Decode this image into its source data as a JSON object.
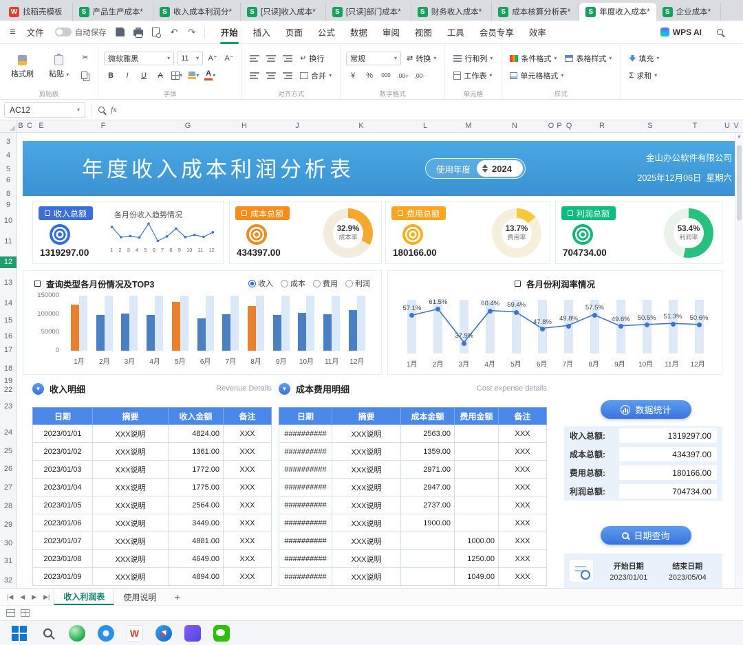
{
  "window_tabs": [
    {
      "label": "找稻壳模板",
      "app": "writer",
      "active": false
    },
    {
      "label": "产品生产成本*",
      "app": "et",
      "active": false
    },
    {
      "label": "收入成本利润分*",
      "app": "et",
      "active": false
    },
    {
      "label": "[只读]收入成本*",
      "app": "et",
      "active": false
    },
    {
      "label": "[只读]部门成本*",
      "app": "et",
      "active": false
    },
    {
      "label": "财务收入成本*",
      "app": "et",
      "active": false
    },
    {
      "label": "成本核算分析表*",
      "app": "et",
      "active": false
    },
    {
      "label": "年度收入成本*",
      "app": "et",
      "active": true
    },
    {
      "label": "企业成本*",
      "app": "et",
      "active": false
    }
  ],
  "menubar": {
    "file_label": "文件",
    "autosave_label": "自动保存",
    "autosave_on": false,
    "tabs": [
      "开始",
      "插入",
      "页面",
      "公式",
      "数据",
      "审阅",
      "视图",
      "工具",
      "会员专享",
      "效率"
    ],
    "active_tab": "开始",
    "wps_ai_label": "WPS AI"
  },
  "ribbon": {
    "format_painter": "格式刷",
    "paste": "粘贴",
    "group_clipboard": "剪贴板",
    "font_name": "微软雅黑",
    "font_size": "11",
    "group_font": "字体",
    "wrap": "换行",
    "merge": "合并",
    "group_align": "对齐方式",
    "number_format": "常规",
    "convert": "转换",
    "group_number": "数字格式",
    "rows_cols": "行和列",
    "worksheet": "工作表",
    "group_cells": "单元格",
    "cond_format": "条件格式",
    "table_style": "表格样式",
    "cell_format": "单元格格式",
    "group_style": "样式",
    "fill": "填充",
    "sum": "求和"
  },
  "formula_bar": {
    "name_box": "AC12",
    "fx_label": "fx"
  },
  "grid": {
    "col_headers": [
      "B",
      "C",
      "E",
      "F",
      "G",
      "H",
      "J",
      "K",
      "L",
      "M",
      "N",
      "O",
      "P",
      "Q",
      "R",
      "S",
      "T",
      "U",
      "V"
    ],
    "row_headers": [
      "3",
      "4",
      "5",
      "6",
      "8",
      "9",
      "10",
      "11",
      "12",
      "13",
      "14",
      "15",
      "16",
      "17",
      "18",
      "19",
      "22",
      "23",
      "24",
      "25",
      "26",
      "27",
      "28",
      "29",
      "30",
      "31",
      "32"
    ],
    "active_row": "12"
  },
  "banner": {
    "title": "年度收入成本利润分析表",
    "year_label": "使用年度",
    "year_value": "2024",
    "company": "金山办公软件有限公司",
    "date": "2025年12月06日",
    "weekday": "星期六"
  },
  "kpi_cards": [
    {
      "badge": "收入总额",
      "badge_color": "#3b6ed6",
      "icon_color": "#2f6fe4",
      "value": "1319297.00"
    },
    {
      "badge": "成本总额",
      "badge_color": "#ff8b17",
      "icon_color": "#f08c1e",
      "value": "434397.00",
      "pct": 32.9,
      "pct_label": "32.9%",
      "rate_label": "成本率",
      "donut_color": "#f5a82d",
      "donut_bg": "#f3ecdd"
    },
    {
      "badge": "费用总额",
      "badge_color": "#ffa41f",
      "icon_color": "#f5b01f",
      "value": "180166.00",
      "pct": 13.7,
      "pct_label": "13.7%",
      "rate_label": "费用率",
      "donut_color": "#f8c83a",
      "donut_bg": "#f5efdc"
    },
    {
      "badge": "利润总额",
      "badge_color": "#0abf7e",
      "icon_color": "#12b878",
      "value": "704734.00",
      "pct": 53.4,
      "pct_label": "53.4%",
      "rate_label": "利润率",
      "donut_color": "#27c07e",
      "donut_bg": "#e9f3ea"
    }
  ],
  "chart_data": [
    {
      "type": "bar",
      "title": "查询类型各月份情况及TOP3",
      "legend": [
        "收入",
        "成本",
        "费用",
        "利润"
      ],
      "selected_legend": "收入",
      "categories": [
        "1月",
        "2月",
        "3月",
        "4月",
        "5月",
        "6月",
        "7月",
        "8月",
        "9月",
        "10月",
        "11月",
        "12月"
      ],
      "values": [
        125000,
        98000,
        101000,
        97000,
        134000,
        88000,
        100000,
        121000,
        98000,
        104000,
        99000,
        111000
      ],
      "highlight_indices": [
        0,
        4,
        7
      ],
      "ylim": [
        0,
        150000
      ],
      "yticks": [
        "0",
        "50000",
        "100000",
        "150000"
      ],
      "bar_color": "#4a7fc1",
      "highlight_color": "#e8802f",
      "track_color": "#dbe8f7"
    },
    {
      "type": "line",
      "title": "各月份利润率情况",
      "categories": [
        "1月",
        "2月",
        "3月",
        "4月",
        "5月",
        "6月",
        "7月",
        "8月",
        "9月",
        "10月",
        "11月",
        "12月"
      ],
      "values": [
        57.1,
        61.5,
        37.9,
        60.4,
        59.4,
        47.8,
        49.8,
        57.5,
        49.6,
        50.5,
        51.3,
        50.6
      ],
      "labels": [
        "57.1%",
        "61.5%",
        "37.9%",
        "60.4%",
        "59.4%",
        "47.8%",
        "49.8%",
        "57.5%",
        "49.6%",
        "50.5%",
        "51.3%",
        "50.6%"
      ],
      "ylim": [
        30,
        68
      ],
      "line_color": "#3e74c4",
      "track_color": "#dde9f7"
    },
    {
      "type": "sparkline",
      "title": "各月份收入趋势情况",
      "categories": [
        "1",
        "2",
        "3",
        "4",
        "5",
        "6",
        "7",
        "8",
        "9",
        "10",
        "11",
        "12"
      ],
      "values": [
        125000,
        98000,
        101000,
        97000,
        134000,
        88000,
        100000,
        121000,
        98000,
        104000,
        99000,
        111000
      ],
      "line_color": "#3e74c4"
    }
  ],
  "tables": {
    "revenue": {
      "title": "收入明细",
      "subtitle": "Revenue Details",
      "headers": [
        "日期",
        "摘要",
        "收入金额",
        "备注"
      ],
      "rows": [
        [
          "2023/01/01",
          "XXX说明",
          "4824.00",
          "XXX"
        ],
        [
          "2023/01/02",
          "XXX说明",
          "1361.00",
          "XXX"
        ],
        [
          "2023/01/03",
          "XXX说明",
          "1772.00",
          "XXX"
        ],
        [
          "2023/01/04",
          "XXX说明",
          "1775.00",
          "XXX"
        ],
        [
          "2023/01/05",
          "XXX说明",
          "2564.00",
          "XXX"
        ],
        [
          "2023/01/06",
          "XXX说明",
          "3449.00",
          "XXX"
        ],
        [
          "2023/01/07",
          "XXX说明",
          "4881.00",
          "XXX"
        ],
        [
          "2023/01/08",
          "XXX说明",
          "4649.00",
          "XXX"
        ],
        [
          "2023/01/09",
          "XXX说明",
          "4894.00",
          "XXX"
        ]
      ]
    },
    "cost": {
      "title": "成本费用明细",
      "subtitle": "Cost expense details",
      "headers": [
        "日期",
        "摘要",
        "成本金额",
        "费用金额",
        "备注"
      ],
      "rows": [
        [
          "##########",
          "XXX说明",
          "2563.00",
          "",
          "XXX"
        ],
        [
          "##########",
          "XXX说明",
          "1359.00",
          "",
          "XXX"
        ],
        [
          "##########",
          "XXX说明",
          "2971.00",
          "",
          "XXX"
        ],
        [
          "##########",
          "XXX说明",
          "2947.00",
          "",
          "XXX"
        ],
        [
          "##########",
          "XXX说明",
          "2737.00",
          "",
          "XXX"
        ],
        [
          "##########",
          "XXX说明",
          "1900.00",
          "",
          "XXX"
        ],
        [
          "##########",
          "XXX说明",
          "",
          "1000.00",
          "XXX"
        ],
        [
          "##########",
          "XXX说明",
          "",
          "1250.00",
          "XXX"
        ],
        [
          "##########",
          "XXX说明",
          "",
          "1049.00",
          "XXX"
        ]
      ]
    }
  },
  "stats_panel": {
    "stats_button": "数据统计",
    "stats": [
      {
        "label": "收入总额:",
        "value": "1319297.00"
      },
      {
        "label": "成本总额:",
        "value": "434397.00"
      },
      {
        "label": "费用总额:",
        "value": "180166.00"
      },
      {
        "label": "利润总额:",
        "value": "704734.00"
      }
    ],
    "query_button": "日期查询",
    "start_label": "开始日期",
    "end_label": "结束日期",
    "start_date": "2023/01/01",
    "end_date": "2023/05/04"
  },
  "sheet_bar": {
    "tabs": [
      {
        "label": "收入利润表",
        "active": true
      },
      {
        "label": "使用说明",
        "active": false
      }
    ],
    "add_label": "+"
  },
  "taskbar": {
    "icons": [
      "windows-start",
      "search",
      "green-browser",
      "blue-browser",
      "wps-writer",
      "compass-app",
      "purple-app",
      "wechat"
    ]
  }
}
